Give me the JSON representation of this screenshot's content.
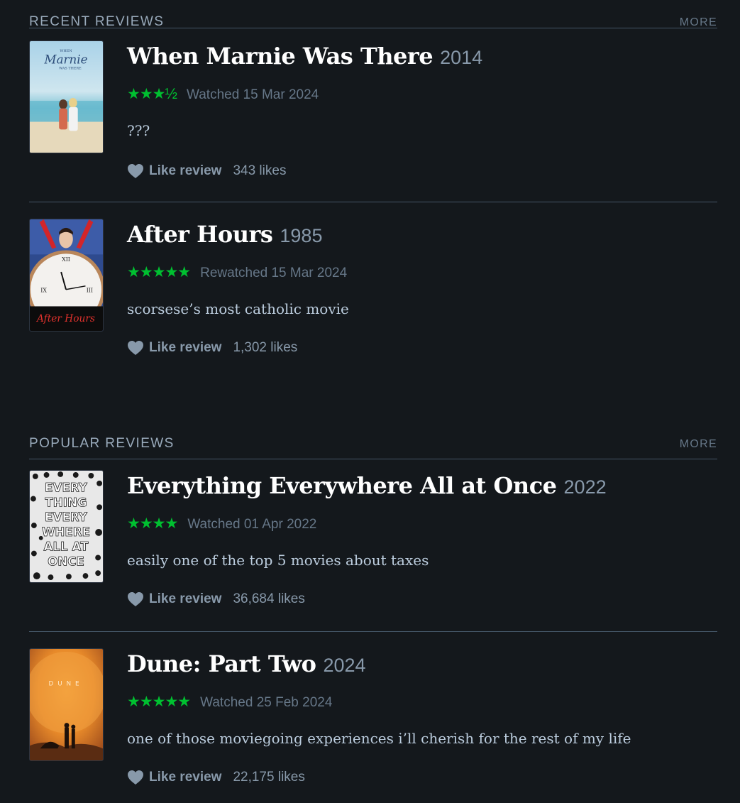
{
  "recent": {
    "title": "RECENT REVIEWS",
    "more": "MORE",
    "reviews": [
      {
        "title": "When Marnie Was There",
        "year": "2014",
        "stars": "★★★½",
        "rating": 3.5,
        "watched": "Watched 15 Mar 2024",
        "text": "???",
        "like_label": "Like review",
        "likes": "343 likes",
        "poster_text": "When Marnie Was There"
      },
      {
        "title": "After Hours",
        "year": "1985",
        "stars": "★★★★★",
        "rating": 5,
        "watched": "Rewatched 15 Mar 2024",
        "text": "scorsese’s most catholic movie",
        "like_label": "Like review",
        "likes": "1,302 likes",
        "poster_text": "After Hours"
      }
    ]
  },
  "popular": {
    "title": "POPULAR REVIEWS",
    "more": "MORE",
    "reviews": [
      {
        "title": "Everything Everywhere All at Once",
        "year": "2022",
        "stars": "★★★★",
        "rating": 4,
        "watched": "Watched 01 Apr 2022",
        "text": "easily one of the top 5 movies about taxes",
        "like_label": "Like review",
        "likes": "36,684 likes",
        "poster_lines": [
          "EVERY",
          "THING",
          "EVERY",
          "WHERE",
          "ALL AT",
          "ONCE"
        ]
      },
      {
        "title": "Dune: Part Two",
        "year": "2024",
        "stars": "★★★★★",
        "rating": 5,
        "watched": "Watched 25 Feb 2024",
        "text": "one of those moviegoing experiences i’ll cherish for the rest of my life",
        "like_label": "Like review",
        "likes": "22,175 likes",
        "poster_text": "DUNE"
      }
    ]
  },
  "colors": {
    "background": "#14181c",
    "star_green": "#00c030",
    "muted": "#8899aa",
    "divider": "#445566"
  }
}
